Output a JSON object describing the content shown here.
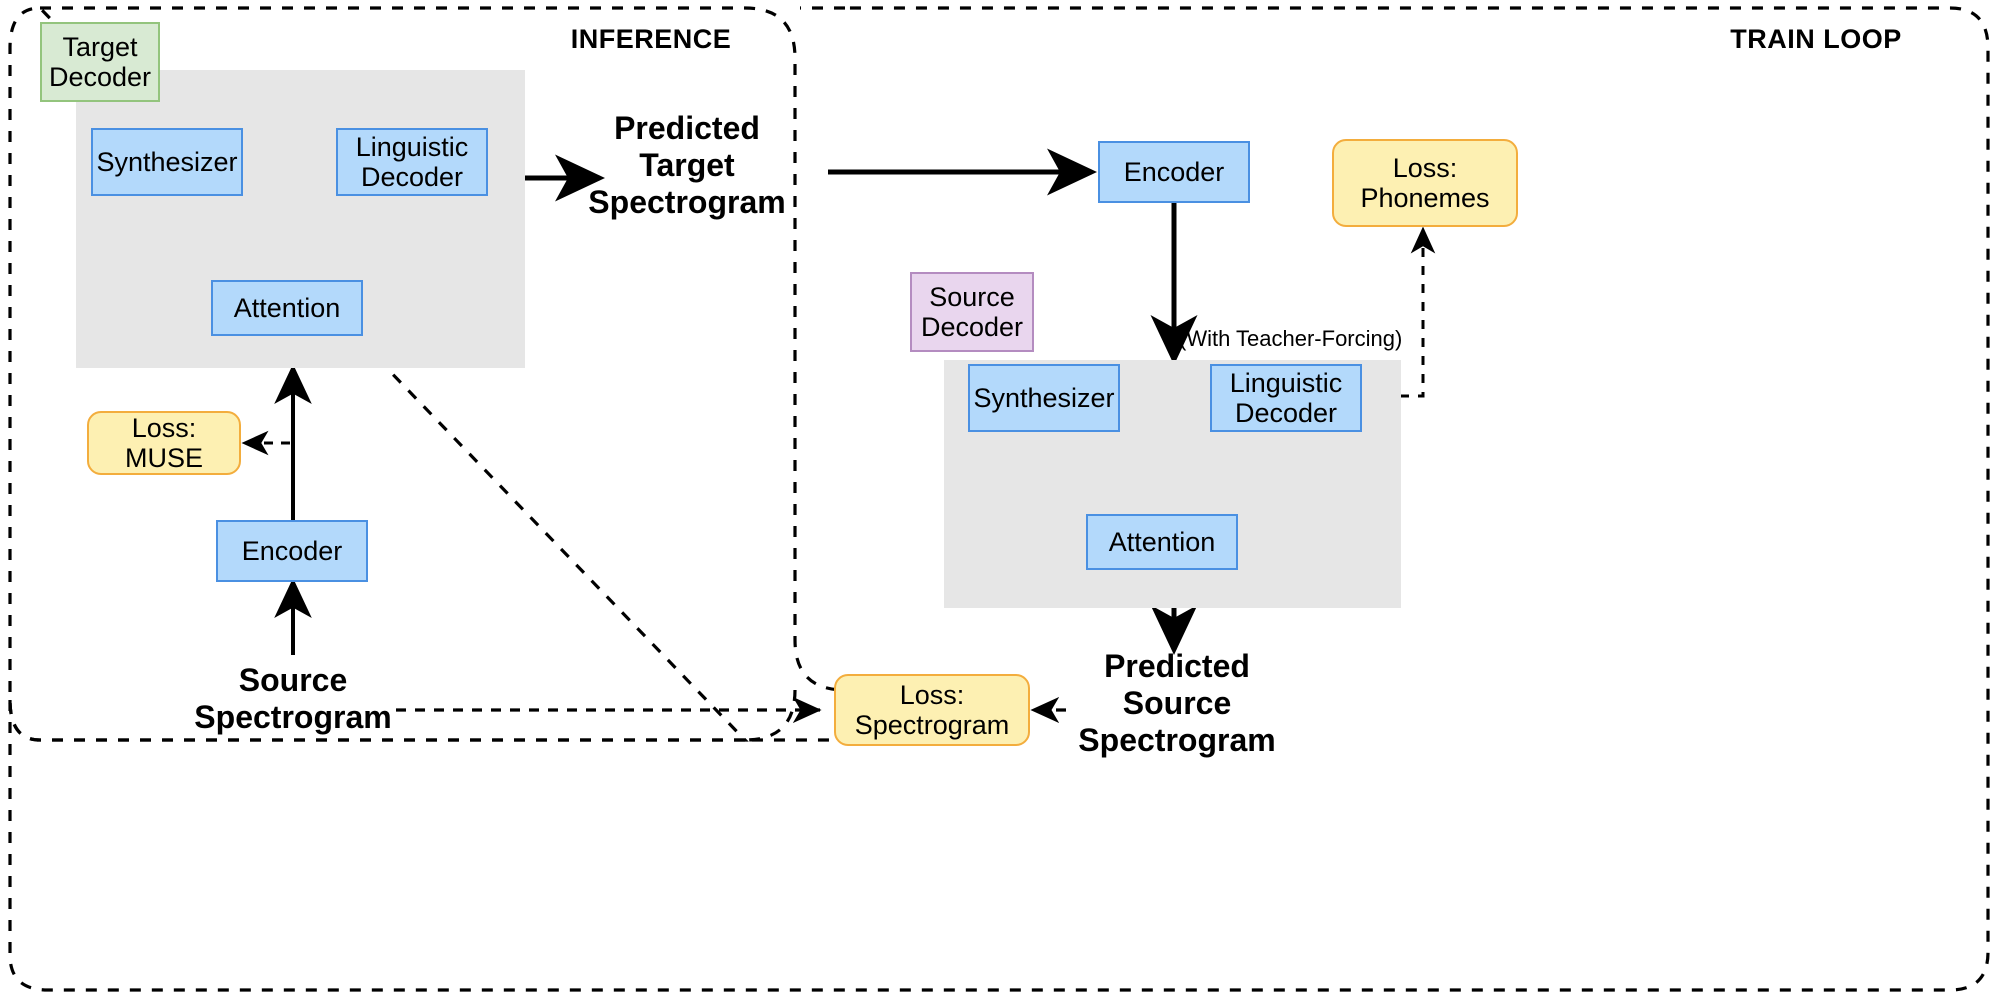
{
  "diagram": {
    "title": "Speech conversion train/inference architecture",
    "colors": {
      "block_fill": "#b3d9fb",
      "block_stroke": "#4a90e2",
      "loss_fill": "#fdf0b2",
      "loss_stroke": "#f3ad3d",
      "target_decoder_fill": "#d8ead3",
      "target_decoder_stroke": "#93c47d",
      "source_decoder_fill": "#e9d6ee",
      "source_decoder_stroke": "#b48cc0",
      "group_fill": "#e6e6e6",
      "line": "#000000"
    }
  },
  "sections": {
    "inference": {
      "label": "INFERENCE"
    },
    "train_loop": {
      "label": "TRAIN LOOP"
    }
  },
  "inference": {
    "target_decoder_tag": "Target\nDecoder",
    "target_decoder_tag_line1": "Target",
    "target_decoder_tag_line2": "Decoder",
    "blocks": {
      "synthesizer": "Synthesizer",
      "linguistic_decoder_line1": "Linguistic",
      "linguistic_decoder_line2": "Decoder",
      "attention": "Attention",
      "encoder": "Encoder"
    },
    "loss_muse_line1": "Loss:",
    "loss_muse_line2": "MUSE",
    "source_spectrogram_line1": "Source",
    "source_spectrogram_line2": "Spectrogram",
    "predicted_target_line1": "Predicted",
    "predicted_target_line2": "Target",
    "predicted_target_line3": "Spectrogram"
  },
  "train": {
    "source_decoder_tag_line1": "Source",
    "source_decoder_tag_line2": "Decoder",
    "teacher_forcing_note": "(With Teacher-Forcing)",
    "blocks": {
      "encoder": "Encoder",
      "synthesizer": "Synthesizer",
      "linguistic_decoder_line1": "Linguistic",
      "linguistic_decoder_line2": "Decoder",
      "attention": "Attention"
    },
    "loss_phonemes_line1": "Loss:",
    "loss_phonemes_line2": "Phonemes",
    "loss_spectrogram_line1": "Loss:",
    "loss_spectrogram_line2": "Spectrogram",
    "predicted_source_line1": "Predicted",
    "predicted_source_line2": "Source",
    "predicted_source_line3": "Spectrogram"
  }
}
